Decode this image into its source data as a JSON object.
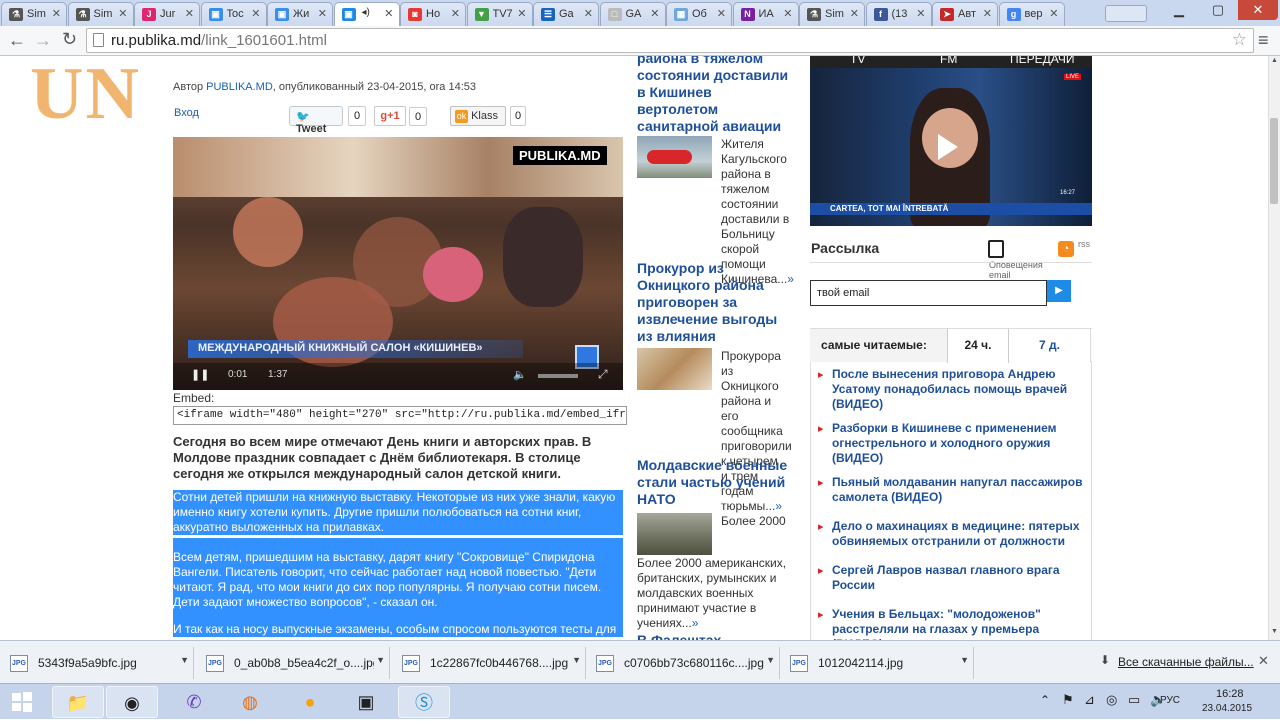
{
  "tabs": [
    {
      "label": "Sim",
      "color": "#555",
      "glyph": "⚗"
    },
    {
      "label": "Sim",
      "color": "#555",
      "glyph": "⚗"
    },
    {
      "label": "Jur",
      "color": "#e0256f",
      "glyph": "J"
    },
    {
      "label": "Toc",
      "color": "#3a8ee6",
      "glyph": "▣"
    },
    {
      "label": "Жи",
      "color": "#3a8ee6",
      "glyph": "▣"
    },
    {
      "label": "",
      "color": "#1e88e5",
      "glyph": "▣",
      "active": true
    },
    {
      "label": "Ho",
      "color": "#e53935",
      "glyph": "◙"
    },
    {
      "label": "TV7",
      "color": "#43a047",
      "glyph": "▼"
    },
    {
      "label": "Ga",
      "color": "#1565c0",
      "glyph": "☰"
    },
    {
      "label": "GA",
      "color": "#bbb",
      "glyph": "□"
    },
    {
      "label": "Об",
      "color": "#6fa8dc",
      "glyph": "▦"
    },
    {
      "label": "ИА",
      "color": "#7b1fa2",
      "glyph": "N"
    },
    {
      "label": "Sim",
      "color": "#555",
      "glyph": "⚗"
    },
    {
      "label": "(13",
      "color": "#3b5998",
      "glyph": "f"
    },
    {
      "label": "Авт",
      "color": "#c62828",
      "glyph": "➤"
    },
    {
      "label": "вер",
      "color": "#4285f4",
      "glyph": "g"
    }
  ],
  "address": {
    "host": "ru.publika.md",
    "path": "/link_1601601.html"
  },
  "logo": "UN",
  "article": {
    "author_prefix": "Автор ",
    "author": "PUBLIKA.MD",
    "published": ", опубликованный 23-04-2015, ora 14:53",
    "login": "Вход",
    "tweet": "Tweet",
    "tweet_count": "0",
    "gplus": "g+1",
    "gplus_count": "0",
    "klass": "Klass",
    "klass_count": "0",
    "video_brand": "PUBLIKA.MD",
    "video_caption": "МЕЖДУНАРОДНЫЙ КНИЖНЫЙ САЛОН «КИШИНЕВ»",
    "video_time": "0:01",
    "video_duration": "1:37",
    "embed_label": "Embed:",
    "embed_code": "<iframe width=\"480\" height=\"270\" src=\"http://ru.publika.md/embed_iframe.php?id=",
    "lead": "Сегодня во всем мире отмечают День книги и авторских прав. В Молдове праздник совпадает с Днём библиотекаря. В столице сегодня же открылся международный салон детской книги.",
    "p1": "Сотни детей пришли на книжную выставку. Некоторые из них уже знали, какую именно книгу хотели купить. Другие пришли полюбоваться на сотни книг, аккуратно выложенных на прилавках.",
    "p2": "Всем детям, пришедшим на выставку, дарят книгу \"Сокровище\" Спиридона Вангели. Писатель говорит, что сейчас работает над новой повестью. \"Дети читают. Я рад, что мои книги до сих пор популярны. Я получаю сотни писем. Дети задают множество вопросов\", - сказал он.",
    "p3": "И так как на носу выпускные экзамены, особым спросом пользуются тесты для"
  },
  "related": [
    {
      "title": "района в тяжелом состоянии доставили в Кишинев вертолетом санитарной авиации",
      "text": "Жителя Кагульского района в тяжелом состоянии доставили в Больницу скорой помощи Кишинева...",
      "more": "»"
    },
    {
      "title": "Прокурор из Окницкого района приговорен за извлечение выгоды из влияния",
      "text": "Прокурора из Окницкого района и его сообщника приговорили к четырем и трем годам тюрьмы...",
      "more": "»"
    },
    {
      "title": "Молдавские военные стали частью учений НАТО",
      "text": "Более 2000 американских, британских, румынских и молдавских военных принимают участие в учениях...",
      "more": "»"
    },
    {
      "title": "В Фалештах"
    }
  ],
  "tvbar": {
    "tv": "TV",
    "fm": "FM",
    "live": "ПЕРЕДАЧИ"
  },
  "tv_ticker": "CARTEA, TOT MAI ÎNTREBATĂ",
  "tv_clock": "16:27",
  "newsletter": {
    "title": "Рассылка",
    "notify": "Оповещения email",
    "rss": "rss",
    "email_value": "твой email"
  },
  "popular": {
    "label": "самые читаемые:",
    "tab24": "24 ч.",
    "tab7": "7 д.",
    "items": [
      "После вынесения приговора Андрею Усатому понадобилась помощь врачей (ВИДЕО)",
      "Разборки в Кишиневе с применением огнестрельного и холодного оружия (ВИДЕО)",
      "Пьяный молдаванин напугал пассажиров самолета (ВИДЕО)",
      "Дело о махинациях в медицине: пятерых обвиняемых отстранили от должности",
      "Сергей Лавров назвал главного врага России",
      "Учения в Бельцах: \"молодоженов\" расстреляли на глазах у премьера (ВИДЕО)"
    ]
  },
  "downloads": {
    "files": [
      "5343f9a5a9bfc.jpg",
      "0_ab0b8_b5ea4c2f_o....jpg",
      "1c22867fc0b446768....jpg",
      "c0706bb73c680116c....jpg",
      "1012042114.jpg"
    ],
    "all": "Все скачанные файлы..."
  },
  "taskbar": {
    "lang": "РУС",
    "time": "16:28",
    "date": "23.04.2015"
  }
}
